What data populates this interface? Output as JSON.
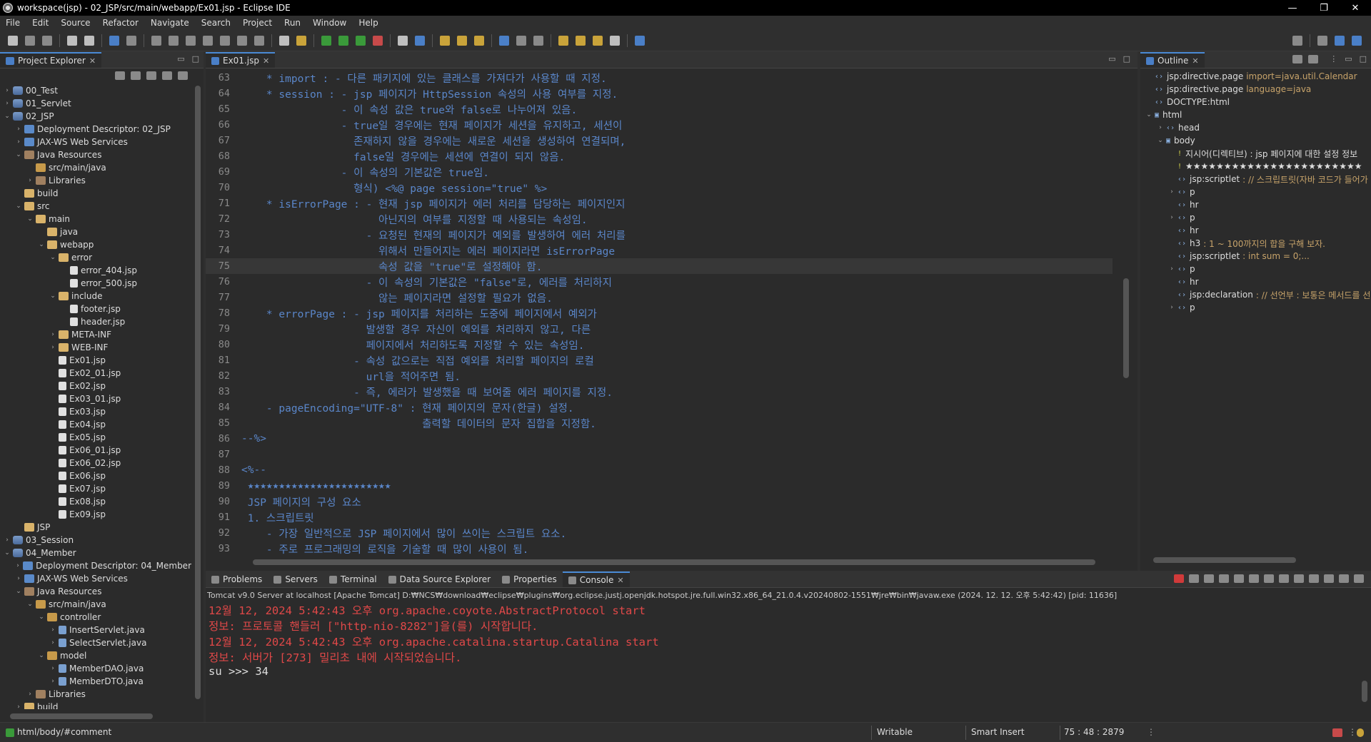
{
  "window": {
    "title": "workspace(jsp) - 02_JSP/src/main/webapp/Ex01.jsp - Eclipse IDE",
    "minimize": "—",
    "maximize": "❐",
    "close": "✕"
  },
  "menu": [
    "File",
    "Edit",
    "Source",
    "Refactor",
    "Navigate",
    "Search",
    "Project",
    "Run",
    "Window",
    "Help"
  ],
  "explorer": {
    "tab_label": "Project Explorer",
    "tree": [
      {
        "indent": 0,
        "arrow": "›",
        "icon": "proj",
        "label": "00_Test"
      },
      {
        "indent": 0,
        "arrow": "›",
        "icon": "proj",
        "label": "01_Servlet"
      },
      {
        "indent": 0,
        "arrow": "⌄",
        "icon": "proj",
        "label": "02_JSP"
      },
      {
        "indent": 1,
        "arrow": "›",
        "icon": "web",
        "label": "Deployment Descriptor: 02_JSP"
      },
      {
        "indent": 1,
        "arrow": "›",
        "icon": "web",
        "label": "JAX-WS Web Services"
      },
      {
        "indent": 1,
        "arrow": "⌄",
        "icon": "lib",
        "label": "Java Resources"
      },
      {
        "indent": 2,
        "arrow": "",
        "icon": "pkg",
        "label": "src/main/java"
      },
      {
        "indent": 2,
        "arrow": "›",
        "icon": "lib",
        "label": "Libraries"
      },
      {
        "indent": 1,
        "arrow": "",
        "icon": "folder",
        "label": "build"
      },
      {
        "indent": 1,
        "arrow": "⌄",
        "icon": "folder",
        "label": "src"
      },
      {
        "indent": 2,
        "arrow": "⌄",
        "icon": "folder",
        "label": "main"
      },
      {
        "indent": 3,
        "arrow": "",
        "icon": "folder",
        "label": "java"
      },
      {
        "indent": 3,
        "arrow": "⌄",
        "icon": "folder",
        "label": "webapp"
      },
      {
        "indent": 4,
        "arrow": "⌄",
        "icon": "folder",
        "label": "error"
      },
      {
        "indent": 5,
        "arrow": "",
        "icon": "file",
        "label": "error_404.jsp"
      },
      {
        "indent": 5,
        "arrow": "",
        "icon": "file",
        "label": "error_500.jsp"
      },
      {
        "indent": 4,
        "arrow": "⌄",
        "icon": "folder",
        "label": "include"
      },
      {
        "indent": 5,
        "arrow": "",
        "icon": "file",
        "label": "footer.jsp"
      },
      {
        "indent": 5,
        "arrow": "",
        "icon": "file",
        "label": "header.jsp"
      },
      {
        "indent": 4,
        "arrow": "›",
        "icon": "folder",
        "label": "META-INF"
      },
      {
        "indent": 4,
        "arrow": "›",
        "icon": "folder",
        "label": "WEB-INF"
      },
      {
        "indent": 4,
        "arrow": "",
        "icon": "file",
        "label": "Ex01.jsp"
      },
      {
        "indent": 4,
        "arrow": "",
        "icon": "file",
        "label": "Ex02_01.jsp"
      },
      {
        "indent": 4,
        "arrow": "",
        "icon": "file",
        "label": "Ex02.jsp"
      },
      {
        "indent": 4,
        "arrow": "",
        "icon": "file",
        "label": "Ex03_01.jsp"
      },
      {
        "indent": 4,
        "arrow": "",
        "icon": "file",
        "label": "Ex03.jsp"
      },
      {
        "indent": 4,
        "arrow": "",
        "icon": "file",
        "label": "Ex04.jsp"
      },
      {
        "indent": 4,
        "arrow": "",
        "icon": "file",
        "label": "Ex05.jsp"
      },
      {
        "indent": 4,
        "arrow": "",
        "icon": "file",
        "label": "Ex06_01.jsp"
      },
      {
        "indent": 4,
        "arrow": "",
        "icon": "file",
        "label": "Ex06_02.jsp"
      },
      {
        "indent": 4,
        "arrow": "",
        "icon": "file",
        "label": "Ex06.jsp"
      },
      {
        "indent": 4,
        "arrow": "",
        "icon": "file",
        "label": "Ex07.jsp"
      },
      {
        "indent": 4,
        "arrow": "",
        "icon": "file",
        "label": "Ex08.jsp"
      },
      {
        "indent": 4,
        "arrow": "",
        "icon": "file",
        "label": "Ex09.jsp"
      },
      {
        "indent": 1,
        "arrow": "",
        "icon": "folder",
        "label": "JSP"
      },
      {
        "indent": 0,
        "arrow": "›",
        "icon": "proj",
        "label": "03_Session"
      },
      {
        "indent": 0,
        "arrow": "⌄",
        "icon": "proj",
        "label": "04_Member"
      },
      {
        "indent": 1,
        "arrow": "›",
        "icon": "web",
        "label": "Deployment Descriptor: 04_Member"
      },
      {
        "indent": 1,
        "arrow": "›",
        "icon": "web",
        "label": "JAX-WS Web Services"
      },
      {
        "indent": 1,
        "arrow": "⌄",
        "icon": "lib",
        "label": "Java Resources"
      },
      {
        "indent": 2,
        "arrow": "⌄",
        "icon": "pkg",
        "label": "src/main/java"
      },
      {
        "indent": 3,
        "arrow": "⌄",
        "icon": "pkg",
        "label": "controller"
      },
      {
        "indent": 4,
        "arrow": "›",
        "icon": "java",
        "label": "InsertServlet.java"
      },
      {
        "indent": 4,
        "arrow": "›",
        "icon": "java",
        "label": "SelectServlet.java"
      },
      {
        "indent": 3,
        "arrow": "⌄",
        "icon": "pkg",
        "label": "model"
      },
      {
        "indent": 4,
        "arrow": "›",
        "icon": "java",
        "label": "MemberDAO.java"
      },
      {
        "indent": 4,
        "arrow": "›",
        "icon": "java",
        "label": "MemberDTO.java"
      },
      {
        "indent": 2,
        "arrow": "›",
        "icon": "lib",
        "label": "Libraries"
      },
      {
        "indent": 1,
        "arrow": "›",
        "icon": "folder",
        "label": "build"
      }
    ]
  },
  "editor": {
    "tab_label": "Ex01.jsp",
    "current_line": "75",
    "lines": [
      {
        "n": "63",
        "text": "    * import : - 다른 패키지에 있는 클래스를 가져다가 사용할 때 지정."
      },
      {
        "n": "64",
        "text": "    * session : - jsp 페이지가 HttpSession 속성의 사용 여부를 지정."
      },
      {
        "n": "65",
        "text": "                - 이 속성 값은 true와 false로 나누어져 있음."
      },
      {
        "n": "66",
        "text": "                - true일 경우에는 현재 페이지가 세션을 유지하고, 세션이"
      },
      {
        "n": "67",
        "text": "                  존재하지 않을 경우에는 새로운 세션을 생성하여 연결되며,"
      },
      {
        "n": "68",
        "text": "                  false일 경우에는 세션에 연결이 되지 않음."
      },
      {
        "n": "69",
        "text": "                - 이 속성의 기본값은 true임."
      },
      {
        "n": "70",
        "text": "                  형식) <%@ page session=\"true\" %>"
      },
      {
        "n": "71",
        "text": "    * isErrorPage : - 현재 jsp 페이지가 에러 처리를 담당하는 페이지인지"
      },
      {
        "n": "72",
        "text": "                      아닌지의 여부를 지정할 때 사용되는 속성임."
      },
      {
        "n": "73",
        "text": "                    - 요청된 현재의 페이지가 예외를 발생하여 에러 처리를"
      },
      {
        "n": "74",
        "text": "                      위해서 만들어지는 에러 페이지라면 isErrorPage"
      },
      {
        "n": "75",
        "text": "                      속성 값을 \"true\"로 설정해야 함."
      },
      {
        "n": "76",
        "text": "                    - 이 속성의 기본값은 \"false\"로, 에러를 처리하지"
      },
      {
        "n": "77",
        "text": "                      않는 페이지라면 설정할 필요가 없음."
      },
      {
        "n": "78",
        "text": "    * errorPage : - jsp 페이지를 처리하는 도중에 페이지에서 예외가"
      },
      {
        "n": "79",
        "text": "                    발생할 경우 자신이 예외를 처리하지 않고, 다른"
      },
      {
        "n": "80",
        "text": "                    페이지에서 처리하도록 지정할 수 있는 속성임."
      },
      {
        "n": "81",
        "text": "                  - 속성 값으로는 직접 예외를 처리할 페이지의 로컬"
      },
      {
        "n": "82",
        "text": "                    url을 적어주면 됨."
      },
      {
        "n": "83",
        "text": "                  - 즉, 에러가 발생했을 때 보여줄 에러 페이지를 지정."
      },
      {
        "n": "84",
        "text": "    - pageEncoding=\"UTF-8\" : 현재 페이지의 문자(한글) 설정."
      },
      {
        "n": "85",
        "text": "                             출력할 데이터의 문자 집합을 지정함."
      },
      {
        "n": "86",
        "text": "--%>"
      },
      {
        "n": "87",
        "text": ""
      },
      {
        "n": "88",
        "text": "<%--"
      },
      {
        "n": "89",
        "text": " ★★★★★★★★★★★★★★★★★★★★★★★"
      },
      {
        "n": "90",
        "text": " JSP 페이지의 구성 요소"
      },
      {
        "n": "91",
        "text": " 1. 스크립트릿"
      },
      {
        "n": "92",
        "text": "    - 가장 일반적으로 JSP 페이지에서 많이 쓰이는 스크립트 요소."
      },
      {
        "n": "93",
        "text": "    - 주로 프로그래밍의 로직을 기술할 때 많이 사용이 됨."
      }
    ]
  },
  "outline": {
    "tab_label": "Outline",
    "items": [
      {
        "indent": 0,
        "arrow": "",
        "icon": "‹›",
        "label": "jsp:directive.page",
        "detail": "import=java.util.Calendar"
      },
      {
        "indent": 0,
        "arrow": "",
        "icon": "‹›",
        "label": "jsp:directive.page",
        "detail": "language=java"
      },
      {
        "indent": 0,
        "arrow": "",
        "icon": "‹›",
        "label": "DOCTYPE:html",
        "detail": ""
      },
      {
        "indent": 0,
        "arrow": "⌄",
        "icon": "▣",
        "label": "html",
        "detail": ""
      },
      {
        "indent": 1,
        "arrow": "›",
        "icon": "‹›",
        "label": "head",
        "detail": ""
      },
      {
        "indent": 1,
        "arrow": "⌄",
        "icon": "▣",
        "label": "body",
        "detail": ""
      },
      {
        "indent": 2,
        "arrow": "",
        "icon": "!",
        "label": "지시어(디렉티브) : jsp 페이지에 대한 설정 정보",
        "detail": ""
      },
      {
        "indent": 2,
        "arrow": "",
        "icon": "!",
        "label": "★★★★★★★★★★★★★★★★★★★★★★★",
        "detail": ""
      },
      {
        "indent": 2,
        "arrow": "",
        "icon": "‹›",
        "label": "jsp:scriptlet",
        "detail": ": // 스크립트릿(자바 코드가 들어가"
      },
      {
        "indent": 2,
        "arrow": "›",
        "icon": "‹›",
        "label": "p",
        "detail": ""
      },
      {
        "indent": 2,
        "arrow": "",
        "icon": "‹›",
        "label": "hr",
        "detail": ""
      },
      {
        "indent": 2,
        "arrow": "›",
        "icon": "‹›",
        "label": "p",
        "detail": ""
      },
      {
        "indent": 2,
        "arrow": "",
        "icon": "‹›",
        "label": "hr",
        "detail": ""
      },
      {
        "indent": 2,
        "arrow": "",
        "icon": "‹›",
        "label": "h3",
        "detail": ": 1 ~ 100까지의 합을 구해 보자."
      },
      {
        "indent": 2,
        "arrow": "",
        "icon": "‹›",
        "label": "jsp:scriptlet",
        "detail": ": int sum = 0;..."
      },
      {
        "indent": 2,
        "arrow": "›",
        "icon": "‹›",
        "label": "p",
        "detail": ""
      },
      {
        "indent": 2,
        "arrow": "",
        "icon": "‹›",
        "label": "hr",
        "detail": ""
      },
      {
        "indent": 2,
        "arrow": "",
        "icon": "‹›",
        "label": "jsp:declaration",
        "detail": ": // 선언부 : 보통은 메서드를 선"
      },
      {
        "indent": 2,
        "arrow": "›",
        "icon": "‹›",
        "label": "p",
        "detail": ""
      }
    ]
  },
  "bottom": {
    "tabs": [
      {
        "label": "Problems",
        "active": false
      },
      {
        "label": "Servers",
        "active": false
      },
      {
        "label": "Terminal",
        "active": false
      },
      {
        "label": "Data Source Explorer",
        "active": false
      },
      {
        "label": "Properties",
        "active": false
      },
      {
        "label": "Console",
        "active": true
      }
    ],
    "console_info": "Tomcat v9.0 Server at localhost [Apache Tomcat] D:₩NCS₩download₩eclipse₩plugins₩org.eclipse.justj.openjdk.hotspot.jre.full.win32.x86_64_21.0.4.v20240802-1551₩jre₩bin₩javaw.exe  (2024. 12. 12. 오후 5:42:42) [pid: 11636]",
    "console_lines": [
      {
        "type": "err",
        "text": "12월 12, 2024 5:42:43 오후 org.apache.coyote.AbstractProtocol start"
      },
      {
        "type": "err",
        "text": "정보: 프로토콜 핸들러 [\"http-nio-8282\"]을(를) 시작합니다."
      },
      {
        "type": "err",
        "text": "12월 12, 2024 5:42:43 오후 org.apache.catalina.startup.Catalina start"
      },
      {
        "type": "err",
        "text": "정보: 서버가 [273] 밀리초 내에 시작되었습니다."
      },
      {
        "type": "out",
        "text": "su >>> 34"
      }
    ]
  },
  "status": {
    "path": "html/body/#comment",
    "writable": "Writable",
    "insert_mode": "Smart Insert",
    "position": "75 : 48 : 2879"
  }
}
